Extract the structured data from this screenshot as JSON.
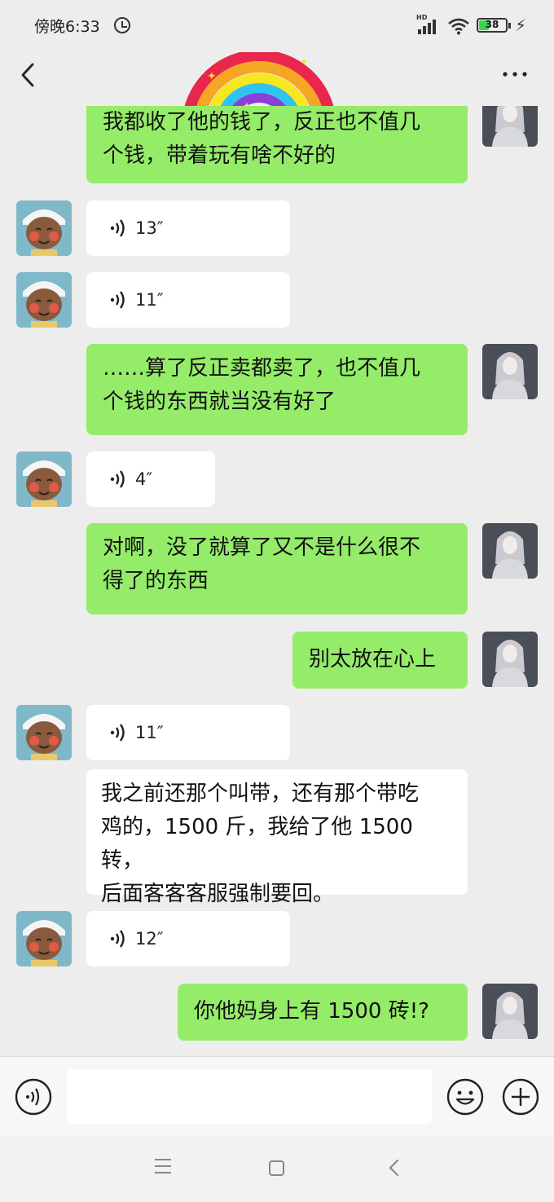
{
  "status_bar": {
    "time": "傍晚6:33",
    "network": "HD",
    "battery_level": "38",
    "icons": [
      "alarm-icon",
      "signal-icon",
      "wifi-icon",
      "battery-icon",
      "charging-icon"
    ]
  },
  "header": {
    "icons": [
      "back-icon",
      "more-icon"
    ],
    "sticker": "rainbow-sticker"
  },
  "messages": [
    {
      "side": "me",
      "type": "text",
      "lines": [
        "我都收了他的钱了，反正也不值几",
        "个钱，带着玩有啥不好的"
      ]
    },
    {
      "side": "them",
      "type": "voice",
      "duration": "13″"
    },
    {
      "side": "them",
      "type": "voice",
      "duration": "11″"
    },
    {
      "side": "me",
      "type": "text",
      "lines": [
        "……算了反正卖都卖了，也不值几",
        "个钱的东西就当没有好了"
      ]
    },
    {
      "side": "them",
      "type": "voice",
      "duration": "4″"
    },
    {
      "side": "me",
      "type": "text",
      "lines": [
        "对啊，没了就算了又不是什么很不",
        "得了的东西"
      ]
    },
    {
      "side": "me",
      "type": "text",
      "lines": [
        "别太放在心上"
      ]
    },
    {
      "side": "them",
      "type": "voice",
      "duration": "11″"
    },
    {
      "side": "them",
      "type": "text",
      "lines": [
        "我之前还那个叫带，还有那个带吃",
        "鸡的，1500 斤，我给了他 1500 转，",
        "后面客客客服强制要回。"
      ]
    },
    {
      "side": "them",
      "type": "voice",
      "duration": "12″"
    },
    {
      "side": "me",
      "type": "text",
      "lines": [
        "你他妈身上有 1500 砖!?"
      ]
    }
  ],
  "input_bar": {
    "value": "",
    "icons": [
      "voice-mode-icon",
      "emoji-icon",
      "plus-icon"
    ]
  },
  "nav_bar": {
    "icons": [
      "menu-icon",
      "home-icon",
      "back-nav-icon"
    ]
  },
  "colors": {
    "my_bubble": "#95ec69",
    "their_bubble": "#ffffff",
    "background": "#ededed"
  }
}
